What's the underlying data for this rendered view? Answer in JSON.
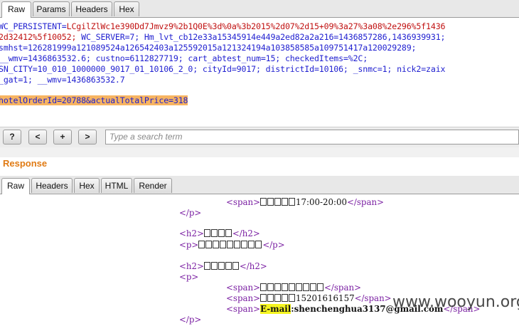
{
  "request_tabs": [
    "Raw",
    "Params",
    "Headers",
    "Hex"
  ],
  "request_lines": [
    {
      "k": "WC_PERSISTENT=",
      "v": "LCgilZlWc1e390Dd7Jmvz9%2b1Q0E%3d%0a%3b2015%2d07%2d15+09%3a27%3a08%2e296%5f1436",
      "x": -2
    },
    {
      "k": "",
      "v": "2d32412%5f10052; ",
      "k2": "WC_SERVER=7; Hm_lvt_cb12e33a15345914e449a2ed82a2a216=1436857286,1436939931;",
      "x": -2
    },
    {
      "k": "smhst=126281999a121089524a126542403a125592015a121324194a103858585a109751417a120029289;",
      "v": "",
      "x": -2
    },
    {
      "k": "__wmv=1436863532.6; custno=6112827719; cart_abtest_num=15; checkedItems=%2C;",
      "v": "",
      "x": -2
    },
    {
      "k": "SN_CITY=10_010_1000000_9017_01_10106_2_0; cityId=9017; districtId=10106; _snmc=1; nick2=zaix",
      "v": "",
      "x": -2
    },
    {
      "k": "_gat=1; __wmv=1436863532.7",
      "v": "",
      "x": -2
    },
    {
      "k": "",
      "v": "",
      "x": 0
    },
    {
      "k": "hotelOrderId=20788&actualTotalPrice=318",
      "v": "",
      "x": -2,
      "hl": true
    }
  ],
  "toolbar": {
    "help_label": "?",
    "prev_label": "<",
    "add_label": "+",
    "next_label": ">",
    "search_placeholder": "Type a search term"
  },
  "response_title": "Response",
  "response_tabs": [
    "Raw",
    "Headers",
    "Hex",
    "HTML",
    "Render"
  ],
  "response_lines": {
    "l1_time": "17:00-20:00",
    "l2_close_p": "</p>",
    "l3_h2_a": "<h2>",
    "l3_h2_b": "</h2>",
    "l4_p_a": "<p>",
    "l4_p_b": "</p>",
    "l5_h2_a": "<h2>",
    "l5_h2_b": "</h2>",
    "l6_p": "<p>",
    "l7_span_a": "<span>",
    "l7_span_b": "</span>",
    "l8_phone": "15201616157",
    "l9_email_label": "E-mail",
    "l9_email_value": ":shenchenghua3137@gmail.com",
    "l10_close_p": "</p>",
    "span_open": "<span>",
    "span_close": "</span>"
  },
  "watermark": "www.wooyun.org"
}
